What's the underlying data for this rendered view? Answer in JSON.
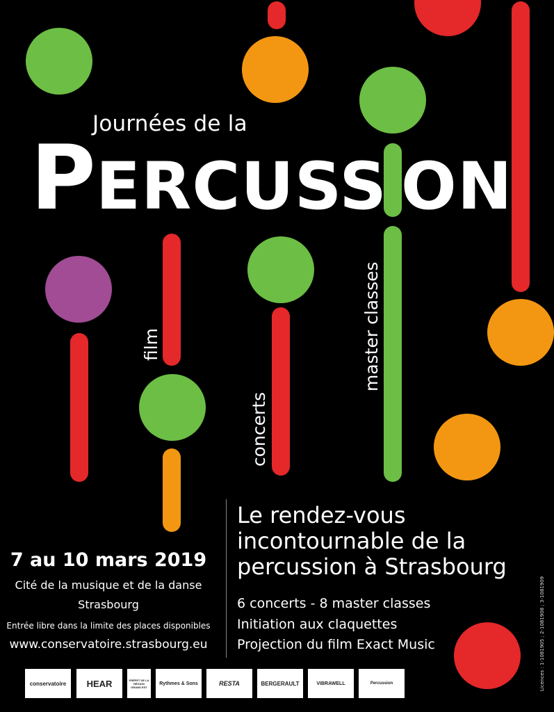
{
  "title": {
    "line1": "Journées de la",
    "p": "P",
    "ercuss": "ERCUSS",
    "i": "I",
    "on": "ON"
  },
  "labels": {
    "film": "film",
    "concerts": "concerts",
    "master": "master classes"
  },
  "tagline": "Le rendez-vous incontournable de la percussion à Strasbourg",
  "program": [
    "6 concerts - 8 master classes",
    "Initiation aux claquettes",
    "Projection du film Exact Music"
  ],
  "event": {
    "dates": "7 au 10 mars 2019",
    "venue": "Cité de la musique et de la danse",
    "city": "Strasbourg",
    "entry": "Entrée libre dans la limite des places disponibles",
    "website": "www.conservatoire.strasbourg.eu"
  },
  "licences": "Licences : 1-1081905 ; 2-1081908 ; 3-1081909",
  "logos": {
    "conservatoire": "conservatoire",
    "hear": "HEAR",
    "prefet": "PRÉFET DE LA RÉGION GRAND EST",
    "rythmes": "Rythmes & Sons",
    "resta": "RESTA",
    "bergerault": "BERGERAULT",
    "vibrawell": "VIBRAWELL",
    "last": "Percussion"
  },
  "colors": {
    "background": "#000000",
    "green": "#6cbe45",
    "orange": "#f39712",
    "red": "#e5282a",
    "purple": "#a14c94"
  }
}
